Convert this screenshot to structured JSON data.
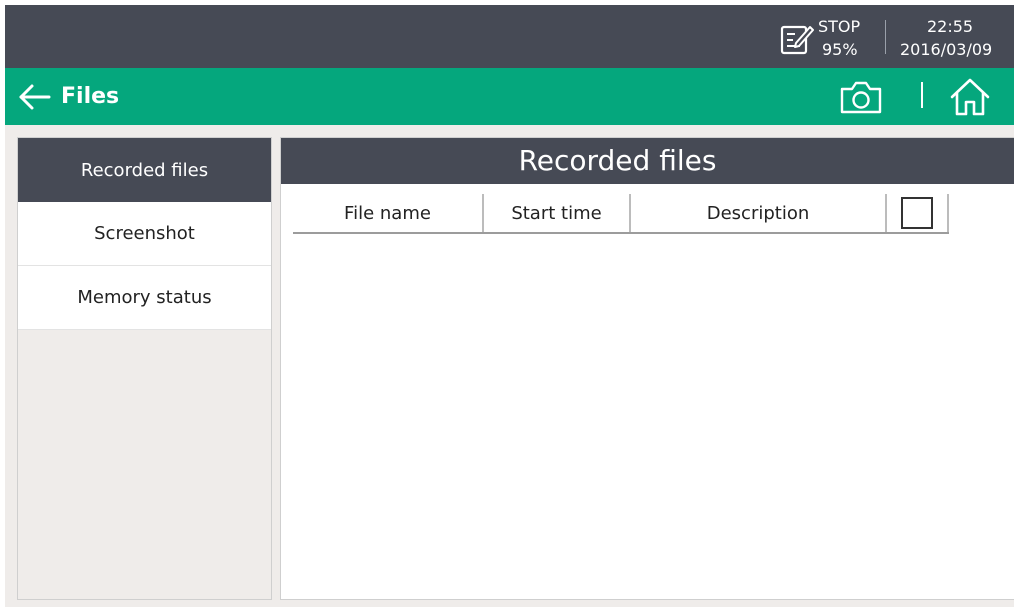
{
  "status": {
    "state": "STOP",
    "battery": "95%",
    "time": "22:55",
    "date": "2016/03/09"
  },
  "header": {
    "title": "Files"
  },
  "sidebar": {
    "items": [
      {
        "label": "Recorded files"
      },
      {
        "label": "Screenshot"
      },
      {
        "label": "Memory status"
      }
    ]
  },
  "main": {
    "title": "Recorded files",
    "columns": [
      "File name",
      "Start time",
      "Description"
    ],
    "rows": []
  },
  "colors": {
    "status_bar": "#464a55",
    "header": "#05a77d",
    "sidebar_active": "#464a55",
    "background": "#efecea"
  },
  "icons": [
    "record-settings-icon",
    "back-arrow-icon",
    "camera-icon",
    "home-icon"
  ]
}
